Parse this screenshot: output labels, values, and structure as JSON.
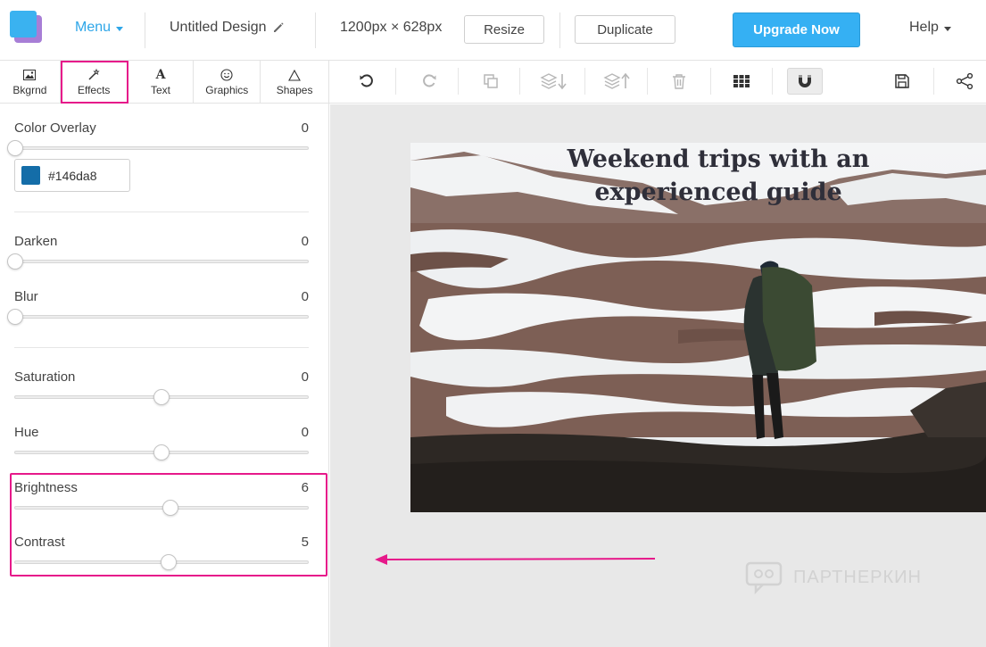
{
  "topbar": {
    "menu_label": "Menu",
    "design_title": "Untitled Design",
    "size_label": "1200px × 628px",
    "resize_label": "Resize",
    "duplicate_label": "Duplicate",
    "upgrade_label": "Upgrade Now",
    "help_label": "Help"
  },
  "sidetabs": [
    {
      "label": "Bkgrnd",
      "icon": "image-icon"
    },
    {
      "label": "Effects",
      "icon": "magic-wand-icon",
      "active": true
    },
    {
      "label": "Text",
      "icon": "text-icon"
    },
    {
      "label": "Graphics",
      "icon": "smiley-icon"
    },
    {
      "label": "Shapes",
      "icon": "triangle-icon"
    }
  ],
  "effects": {
    "color_overlay": {
      "label": "Color Overlay",
      "value": "0",
      "level": 0.0,
      "color_hex": "#146da8",
      "color": "#146da8"
    },
    "darken": {
      "label": "Darken",
      "value": "0",
      "level": 0.0
    },
    "blur": {
      "label": "Blur",
      "value": "0",
      "level": 0.0
    },
    "saturation": {
      "label": "Saturation",
      "value": "0",
      "level": 0.5
    },
    "hue": {
      "label": "Hue",
      "value": "0",
      "level": 0.5
    },
    "brightness": {
      "label": "Brightness",
      "value": "6",
      "level": 0.53
    },
    "contrast": {
      "label": "Contrast",
      "value": "5",
      "level": 0.525
    }
  },
  "toolbar": {
    "buttons": [
      "undo-icon",
      "redo-icon",
      "copy-icon",
      "send-backward-icon",
      "bring-forward-icon",
      "trash-icon",
      "grid-icon",
      "magnet-icon",
      "save-icon",
      "share-icon"
    ]
  },
  "canvas": {
    "headline_line1": "Weekend trips with an",
    "headline_line2": "experienced guide"
  },
  "watermark": {
    "text": "ПАРТНЕРКИН"
  },
  "colors": {
    "accent": "#2ea6e8",
    "upgrade": "#35b0f3",
    "highlight": "#e6198a"
  }
}
